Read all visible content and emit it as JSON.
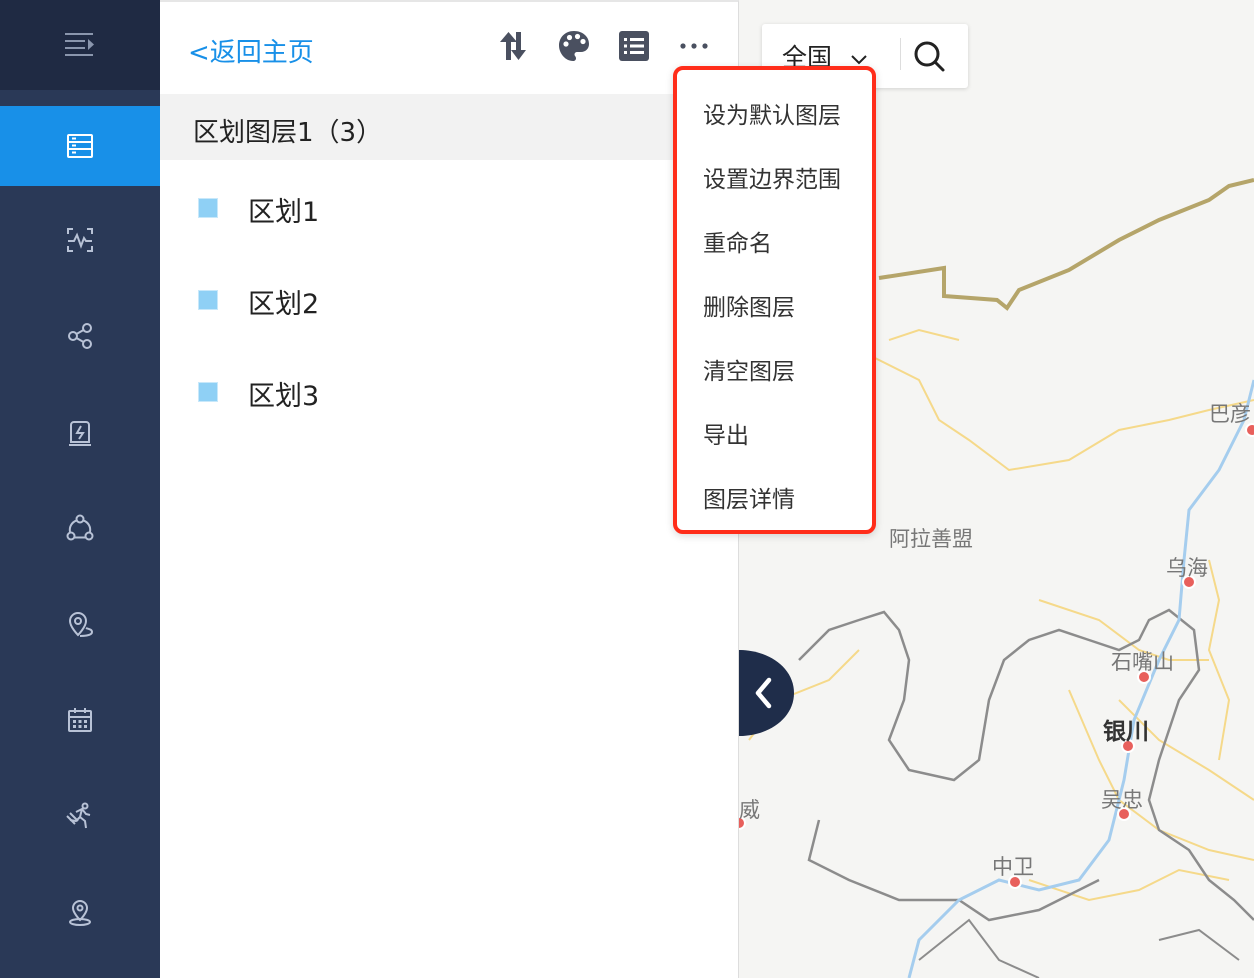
{
  "nav": {
    "back_label": "<返回主页"
  },
  "layer": {
    "title": "区划图层1（3）",
    "regions": [
      {
        "label": "区划1"
      },
      {
        "label": "区划2"
      },
      {
        "label": "区划3"
      }
    ]
  },
  "search": {
    "region_label": "全国"
  },
  "menu": {
    "items": [
      {
        "label": "设为默认图层"
      },
      {
        "label": "设置边界范围"
      },
      {
        "label": "重命名"
      },
      {
        "label": "删除图层"
      },
      {
        "label": "清空图层"
      },
      {
        "label": "导出"
      },
      {
        "label": "图层详情"
      }
    ]
  },
  "map": {
    "labels": {
      "bayan": "巴彦",
      "alashan": "阿拉善盟",
      "wuhai": "乌海",
      "shizuishan": "石嘴山",
      "yinchuan": "银川",
      "wuzhong": "吴忠",
      "wei": "威",
      "zhongwei": "中卫"
    }
  },
  "colors": {
    "accent": "#1890e8",
    "sidebar": "#2a3957",
    "highlight_border": "#ff2d1a"
  },
  "icons": [
    "menu-expand-icon",
    "layers-icon",
    "heartbeat-icon",
    "share-icon",
    "alert-doc-icon",
    "network-icon",
    "location-route-icon",
    "calendar-icon",
    "runner-icon",
    "location-pin-icon",
    "sort-icon",
    "palette-icon",
    "list-icon",
    "more-icon",
    "chevron-down-icon",
    "search-icon",
    "chevron-left-icon"
  ]
}
